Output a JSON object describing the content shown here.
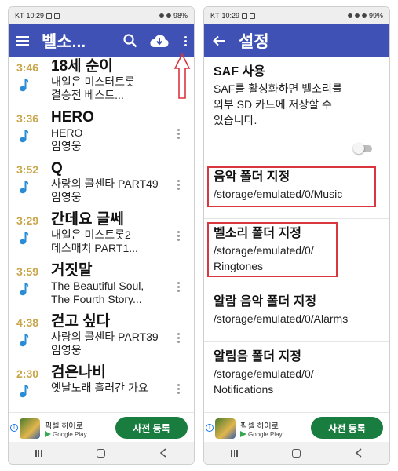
{
  "status_left": {
    "carrier": "KT",
    "time": "10:29",
    "battery": "98%"
  },
  "status_right": {
    "carrier": "KT",
    "time": "10:29",
    "battery": "99%"
  },
  "left_appbar": {
    "title": "벨소..."
  },
  "songs": [
    {
      "duration": "3:46",
      "title": "18세 순이",
      "line1": "내일은 미스터트롯",
      "line2": "결승전 베스트..."
    },
    {
      "duration": "3:36",
      "title": "HERO",
      "line1": "HERO",
      "line2": "임영웅"
    },
    {
      "duration": "3:52",
      "title": "Q",
      "line1": "사랑의 콜센타 PART49",
      "line2": "임영웅"
    },
    {
      "duration": "3:29",
      "title": "간데요 글쎄",
      "line1": "내일은 미스트롯2",
      "line2": "데스매치 PART1..."
    },
    {
      "duration": "3:59",
      "title": "거짓말",
      "line1": "The Beautiful Soul,",
      "line2": "The Fourth Story..."
    },
    {
      "duration": "4:38",
      "title": "걷고 싶다",
      "line1": "사랑의 콜센타 PART39",
      "line2": "임영웅"
    },
    {
      "duration": "2:30",
      "title": "검은나비",
      "line1": "옛날노래 흘러간 가요",
      "line2": ""
    }
  ],
  "right_appbar": {
    "title": "설정"
  },
  "settings": {
    "saf_title": "SAF 사용",
    "saf_desc1": "SAF를 활성화하면 벨소리를",
    "saf_desc2": "외부 SD 카드에 저장할 수",
    "saf_desc3": "있습니다.",
    "music_title": "음악 폴더 지정",
    "music_path": "/storage/emulated/0/Music",
    "ringtone_title": "벨소리 폴더 지정",
    "ringtone_path1": "/storage/emulated/0/",
    "ringtone_path2": "Ringtones",
    "alarm_title": "알람 음악 폴더 지정",
    "alarm_path": "/storage/emulated/0/Alarms",
    "notif_title": "알림음 폴더 지정",
    "notif_path1": "/storage/emulated/0/",
    "notif_path2": "Notifications"
  },
  "ad": {
    "app_name": "픽셀 히어로",
    "store": "Google Play",
    "cta": "사전 등록"
  },
  "colors": {
    "appbar": "#3f51b5",
    "duration": "#c9a64a",
    "note": "#2a8bd6",
    "highlight": "#d9363e",
    "cta": "#197d3f"
  }
}
